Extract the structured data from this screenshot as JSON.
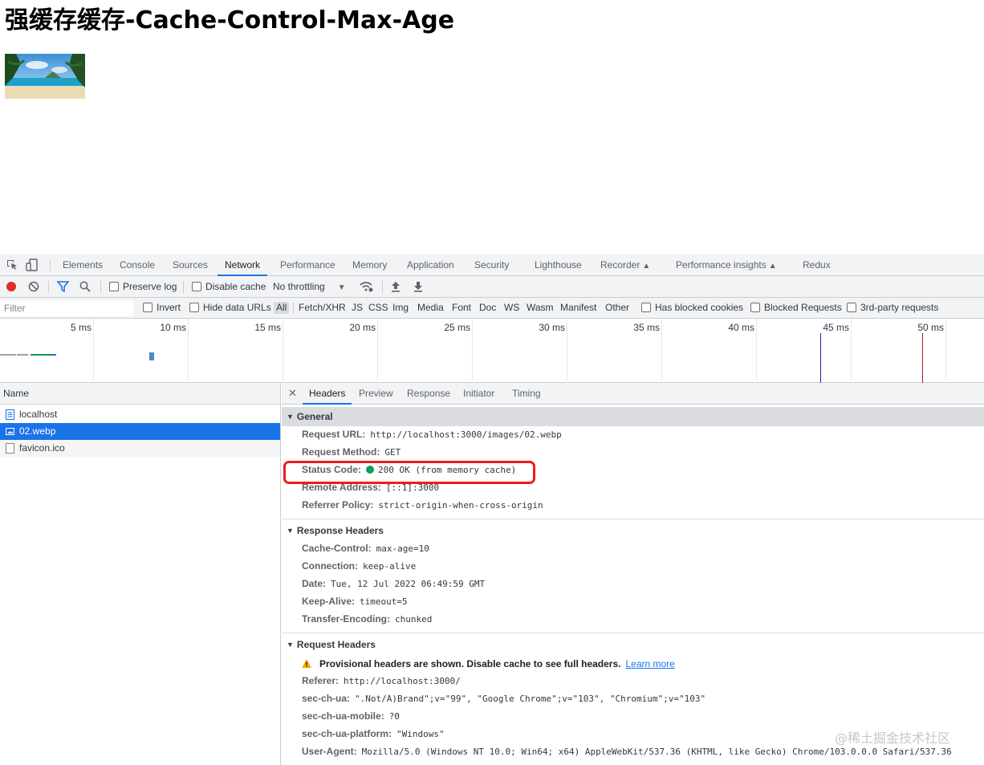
{
  "page": {
    "title": "强缓存缓存-Cache-Control-Max-Age"
  },
  "devtools": {
    "main_tabs": [
      "Elements",
      "Console",
      "Sources",
      "Network",
      "Performance",
      "Memory",
      "Application",
      "Security",
      "Lighthouse",
      "Recorder",
      "Performance insights",
      "Redux"
    ],
    "active_tab": "Network",
    "toolbar": {
      "preserve_log": "Preserve log",
      "disable_cache": "Disable cache",
      "throttling": "No throttling"
    },
    "filter": {
      "placeholder": "Filter",
      "invert": "Invert",
      "hide_data_urls": "Hide data URLs",
      "types": [
        "All",
        "Fetch/XHR",
        "JS",
        "CSS",
        "Img",
        "Media",
        "Font",
        "Doc",
        "WS",
        "Wasm",
        "Manifest",
        "Other"
      ],
      "has_blocked_cookies": "Has blocked cookies",
      "blocked_requests": "Blocked Requests",
      "third_party": "3rd-party requests"
    },
    "timeline": {
      "ticks": [
        "5 ms",
        "10 ms",
        "15 ms",
        "20 ms",
        "25 ms",
        "30 ms",
        "35 ms",
        "40 ms",
        "45 ms",
        "50 ms"
      ]
    },
    "requests": {
      "column_name": "Name",
      "rows": [
        {
          "name": "localhost"
        },
        {
          "name": "02.webp"
        },
        {
          "name": "favicon.ico"
        }
      ],
      "selected_index": 1
    },
    "details": {
      "tabs": [
        "Headers",
        "Preview",
        "Response",
        "Initiator",
        "Timing"
      ],
      "active_tab": "Headers",
      "general": {
        "title": "General",
        "rows": [
          {
            "key": "Request URL:",
            "value": "http://localhost:3000/images/02.webp"
          },
          {
            "key": "Request Method:",
            "value": "GET"
          },
          {
            "key": "Status Code:",
            "value": "200 OK (from memory cache)"
          },
          {
            "key": "Remote Address:",
            "value": "[::1]:3000"
          },
          {
            "key": "Referrer Policy:",
            "value": "strict-origin-when-cross-origin"
          }
        ]
      },
      "response_headers": {
        "title": "Response Headers",
        "rows": [
          {
            "key": "Cache-Control:",
            "value": "max-age=10"
          },
          {
            "key": "Connection:",
            "value": "keep-alive"
          },
          {
            "key": "Date:",
            "value": "Tue, 12 Jul 2022 06:49:59 GMT"
          },
          {
            "key": "Keep-Alive:",
            "value": "timeout=5"
          },
          {
            "key": "Transfer-Encoding:",
            "value": "chunked"
          }
        ]
      },
      "request_headers": {
        "title": "Request Headers",
        "warning": "Provisional headers are shown. Disable cache to see full headers.",
        "learn_more": "Learn more",
        "rows": [
          {
            "key": "Referer:",
            "value": "http://localhost:3000/"
          },
          {
            "key": "sec-ch-ua:",
            "value": "\".Not/A)Brand\";v=\"99\", \"Google Chrome\";v=\"103\", \"Chromium\";v=\"103\""
          },
          {
            "key": "sec-ch-ua-mobile:",
            "value": "?0"
          },
          {
            "key": "sec-ch-ua-platform:",
            "value": "\"Windows\""
          },
          {
            "key": "User-Agent:",
            "value": "Mozilla/5.0 (Windows NT 10.0; Win64; x64) AppleWebKit/537.36 (KHTML, like Gecko) Chrome/103.0.0.0 Safari/537.36"
          }
        ]
      }
    }
  },
  "watermark": "@稀土掘金技术社区",
  "colors": {
    "accent": "#1a73e8",
    "highlight": "#ee1c1c",
    "status_ok": "#0f9d58",
    "record": "#d93025"
  }
}
